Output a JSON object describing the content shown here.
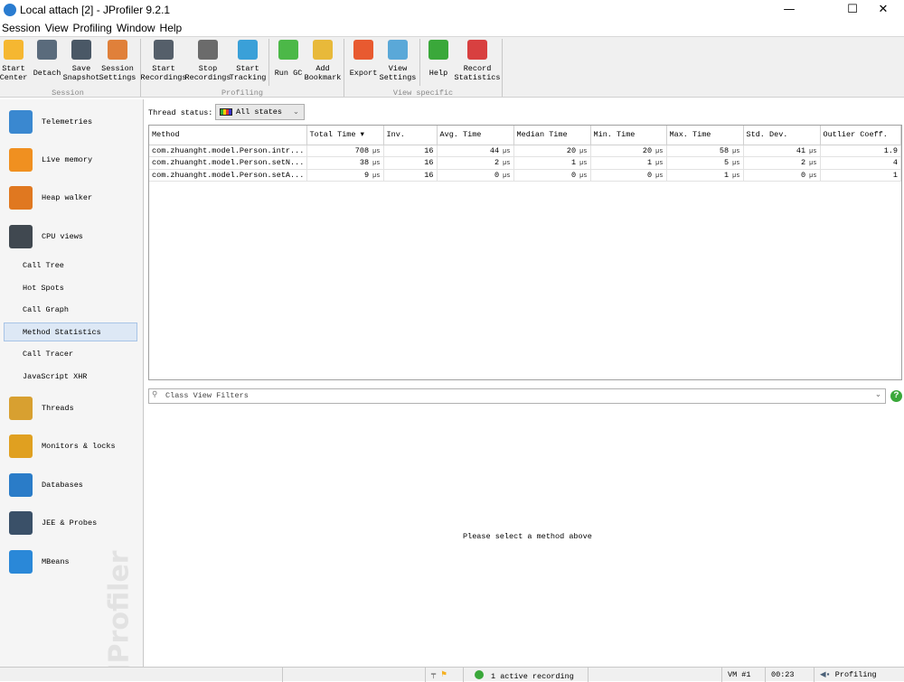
{
  "window": {
    "title": "Local attach [2] - JProfiler 9.2.1",
    "min": "—",
    "max": "☐",
    "close": "✕"
  },
  "menu": [
    "Session",
    "View",
    "Profiling",
    "Window",
    "Help"
  ],
  "toolbar": {
    "buttons": [
      {
        "label": "Start Center",
        "icon": "folder-play-icon",
        "color": "#f5b731"
      },
      {
        "label": "Detach",
        "icon": "plug-detach-icon",
        "color": "#5a6b7c"
      },
      {
        "label": "Save Snapshot",
        "icon": "floppy-disk-icon",
        "color": "#4a5866"
      },
      {
        "label": "Session Settings",
        "icon": "clipboard-edit-icon",
        "color": "#e0803a"
      },
      {
        "label": "Start Recordings",
        "icon": "film-reel-play-icon",
        "color": "#555f6a"
      },
      {
        "label": "Stop Recordings",
        "icon": "film-reel-stop-icon",
        "color": "#6b6b6b"
      },
      {
        "label": "Start Tracking",
        "icon": "tracking-icon",
        "color": "#3aa0d8"
      },
      {
        "label": "Run GC",
        "icon": "recycle-icon",
        "color": "#4cb848"
      },
      {
        "label": "Add Bookmark",
        "icon": "bookmark-add-icon",
        "color": "#e8b93a"
      },
      {
        "label": "Export",
        "icon": "export-arrow-icon",
        "color": "#e85a30"
      },
      {
        "label": "View Settings",
        "icon": "view-settings-icon",
        "color": "#5aa8d8"
      },
      {
        "label": "Help",
        "icon": "help-icon",
        "color": "#3aa83a"
      },
      {
        "label": "Record Statistics",
        "icon": "stopwatch-icon",
        "color": "#d84040"
      }
    ],
    "groups": [
      "Session",
      "Profiling",
      "View specific"
    ]
  },
  "sidebar": {
    "items": [
      {
        "label": "Telemetries",
        "icon": "telemetries-icon",
        "color": "#3a88d0"
      },
      {
        "label": "Live memory",
        "icon": "live-memory-icon",
        "color": "#f09020"
      },
      {
        "label": "Heap walker",
        "icon": "heap-walker-icon",
        "color": "#e07820"
      },
      {
        "label": "CPU views",
        "icon": "cpu-icon",
        "color": "#404850"
      },
      {
        "label": "Threads",
        "icon": "threads-icon",
        "color": "#d8a030"
      },
      {
        "label": "Monitors & locks",
        "icon": "lock-icon",
        "color": "#e0a020"
      },
      {
        "label": "Databases",
        "icon": "database-icon",
        "color": "#2a7cc8"
      },
      {
        "label": "JEE & Probes",
        "icon": "gauge-icon",
        "color": "#3a5068"
      },
      {
        "label": "MBeans",
        "icon": "globe-icon",
        "color": "#2a88d8"
      }
    ],
    "cpu_sub": [
      "Call Tree",
      "Hot Spots",
      "Call Graph",
      "Method Statistics",
      "Call Tracer",
      "JavaScript XHR"
    ],
    "selected": "Method Statistics",
    "watermark": "JProfiler"
  },
  "main": {
    "thread_status_label": "Thread status:",
    "thread_status_value": "All states",
    "columns": [
      "Method",
      "Total Time ▾",
      "Inv.",
      "Avg. Time",
      "Median Time",
      "Min. Time",
      "Max. Time",
      "Std. Dev.",
      "Outlier Coeff."
    ],
    "unit": "µs",
    "rows": [
      [
        "com.zhuanght.model.Person.intr...",
        "708",
        "16",
        "44",
        "20",
        "20",
        "58",
        "41",
        "1.9"
      ],
      [
        "com.zhuanght.model.Person.setN...",
        "38",
        "16",
        "2",
        "1",
        "1",
        "5",
        "2",
        "4"
      ],
      [
        "com.zhuanght.model.Person.setA...",
        "9",
        "16",
        "0",
        "0",
        "0",
        "1",
        "0",
        "1"
      ]
    ],
    "filter_placeholder": "Class View Filters",
    "empty_message": "Please select a method above"
  },
  "status": {
    "recording": "1 active recording",
    "vm": "VM #1",
    "time": "00:23",
    "mode": "Profiling"
  }
}
